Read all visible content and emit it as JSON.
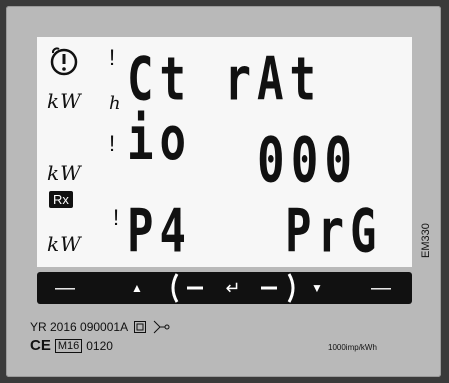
{
  "lcd": {
    "row1_text": "Ct rAt io",
    "row2_text": "000",
    "row3_left": "P4",
    "row3_right": "PrG",
    "unit_label": "kW",
    "warning_mark": "!",
    "h_label": "h",
    "rx_label": "Rx"
  },
  "keys": {
    "left_dash": "—",
    "up_label": "▲",
    "enter_label": "↵",
    "down_label": "▼",
    "right_dash": "—"
  },
  "device": {
    "model": "EM330",
    "serial": "YR 2016 090001A",
    "ce_mark": "CE",
    "m_mark": "M16",
    "code": "0120",
    "impulse": "1000imp/kWh"
  }
}
